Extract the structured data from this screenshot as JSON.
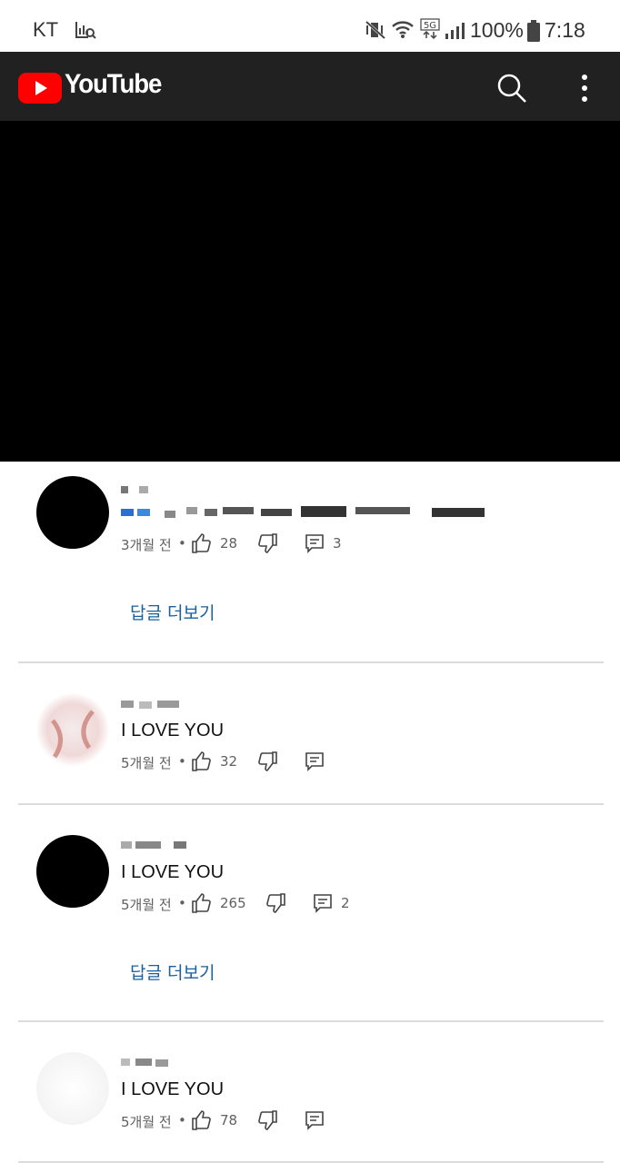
{
  "status_bar": {
    "carrier": "KT",
    "battery": "100%",
    "time": "7:18"
  },
  "app_bar": {
    "title": "YouTube",
    "icons": [
      "youtube-logo-icon",
      "search-icon",
      "more-vert-icon"
    ]
  },
  "colors": {
    "appbar": "#212121",
    "logo_red": "#ff0000",
    "link_blue": "#1a5fa0"
  },
  "comments": [
    {
      "text": "",
      "time": "3개월 전",
      "likes": "28",
      "replies": "3",
      "reply_link": "답글 더보기"
    },
    {
      "text": "I LOVE YOU",
      "time": "5개월 전",
      "likes": "32",
      "replies": ""
    },
    {
      "text": "I LOVE YOU",
      "time": "5개월 전",
      "likes": "265",
      "replies": "2",
      "reply_link": "답글 더보기"
    },
    {
      "text": "I LOVE YOU",
      "time": "5개월 전",
      "likes": "78",
      "replies": ""
    }
  ]
}
